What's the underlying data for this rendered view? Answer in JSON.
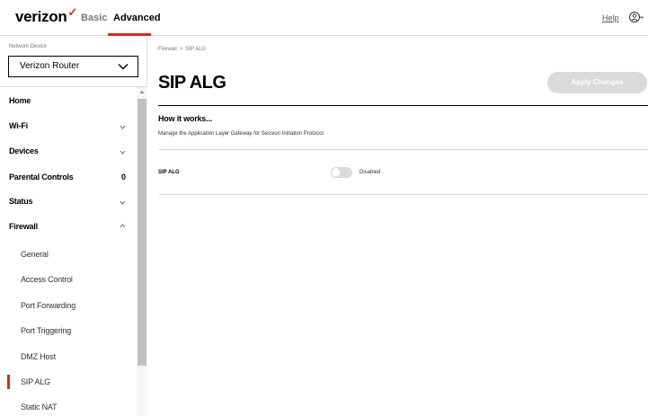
{
  "header": {
    "logo_text": "verizon",
    "logo_mark": "✓",
    "tabs": [
      {
        "label": "Basic",
        "active": false
      },
      {
        "label": "Advanced",
        "active": true
      }
    ],
    "help_label": "Help",
    "user_icon": "user-icon",
    "accent_color": "#d52b1e"
  },
  "sidebar": {
    "network_device_label": "Network Device",
    "network_device_value": "Verizon Router",
    "menu": [
      {
        "label": "Home",
        "type": "item"
      },
      {
        "label": "Wi-Fi",
        "type": "item",
        "chevron": "down"
      },
      {
        "label": "Devices",
        "type": "item",
        "chevron": "down"
      },
      {
        "label": "Parental Controls",
        "type": "item",
        "count": "0"
      },
      {
        "label": "Status",
        "type": "item",
        "chevron": "down"
      },
      {
        "label": "Firewall",
        "type": "item",
        "chevron": "up",
        "expanded": true
      }
    ],
    "submenu": [
      {
        "label": "General",
        "active": false
      },
      {
        "label": "Access Control",
        "active": false
      },
      {
        "label": "Port Forwarding",
        "active": false
      },
      {
        "label": "Port Triggering",
        "active": false
      },
      {
        "label": "DMZ Host",
        "active": false
      },
      {
        "label": "SIP ALG",
        "active": true
      },
      {
        "label": "Static NAT",
        "active": false
      }
    ]
  },
  "main": {
    "breadcrumb": [
      "Firewall",
      ">",
      "SIP ALG"
    ],
    "title": "SIP ALG",
    "apply_label": "Apply Changes",
    "how_it_works_title": "How it works...",
    "how_it_works_desc": "Manage the Application Layer Gateway for Session Initiation Protocol",
    "setting": {
      "label": "SIP ALG",
      "enabled": false,
      "status_text": "Disabled"
    }
  }
}
